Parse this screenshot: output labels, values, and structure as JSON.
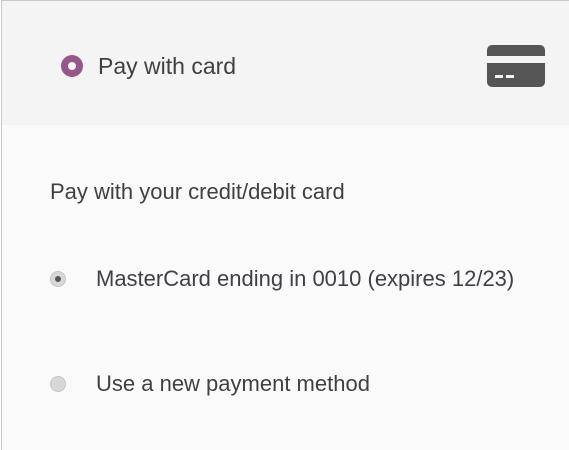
{
  "payment_method": {
    "label": "Pay with card",
    "icon": "credit-card-icon",
    "accent_color": "#96588a",
    "description": "Pay with your credit/debit card",
    "options": [
      {
        "label": "MasterCard ending in 0010 (expires 12/23)",
        "selected": true
      },
      {
        "label": "Use a new payment method",
        "selected": false
      }
    ]
  }
}
